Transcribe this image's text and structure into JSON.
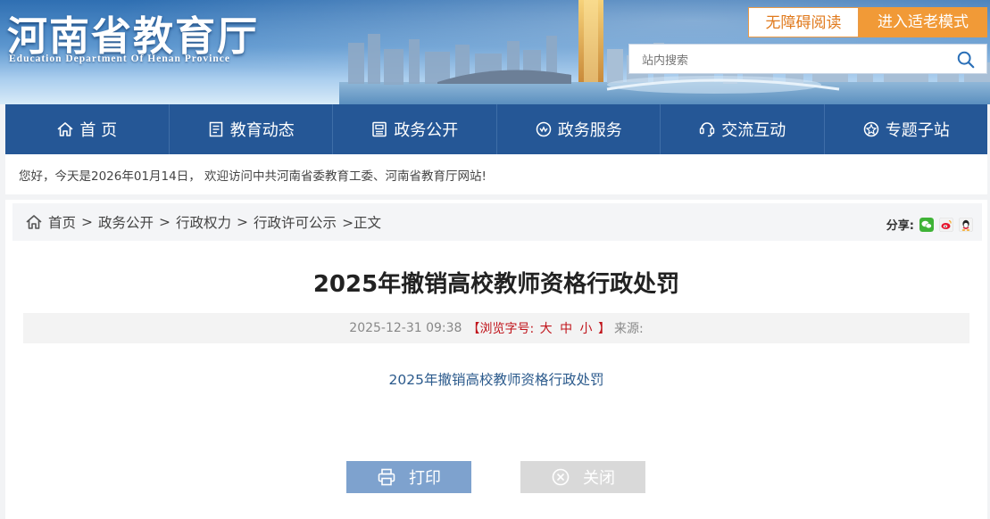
{
  "header": {
    "logo_cn": "河南省教育厅",
    "logo_en": "Education Department Of Henan Province",
    "accessibility_label": "无障碍阅读",
    "elder_mode_label": "进入适老模式",
    "search_placeholder": "站内搜索"
  },
  "nav": {
    "items": [
      {
        "label": "首 页",
        "icon": "home-icon"
      },
      {
        "label": "教育动态",
        "icon": "document-icon"
      },
      {
        "label": "政务公开",
        "icon": "list-icon"
      },
      {
        "label": "政务服务",
        "icon": "service-icon"
      },
      {
        "label": "交流互动",
        "icon": "interaction-icon"
      },
      {
        "label": "专题子站",
        "icon": "topic-icon"
      }
    ]
  },
  "welcome": "您好，今天是2026年01月14日， 欢迎访问中共河南省委教育工委、河南省教育厅网站!",
  "breadcrumb": {
    "items": [
      "首页",
      "政务公开",
      "行政权力",
      "行政许可公示"
    ],
    "current": ">正文",
    "sep": ">"
  },
  "share": {
    "label": "分享:",
    "icons": [
      "wechat-icon",
      "weibo-icon",
      "qq-icon"
    ]
  },
  "article": {
    "title": "2025年撤销高校教师资格行政处罚",
    "date": "2025-12-31 09:38",
    "font_size_prefix": "【浏览字号:",
    "font_sizes": [
      "大",
      "中",
      "小"
    ],
    "font_size_suffix": "】",
    "source_label": "来源:",
    "body_link": "2025年撤销高校教师资格行政处罚"
  },
  "actions": {
    "print_label": "打印",
    "close_label": "关闭"
  },
  "colors": {
    "nav_bg": "#255796",
    "accent_orange": "#f19a37",
    "link_blue": "#2b5a8c",
    "font_size_red": "#c0141b"
  }
}
